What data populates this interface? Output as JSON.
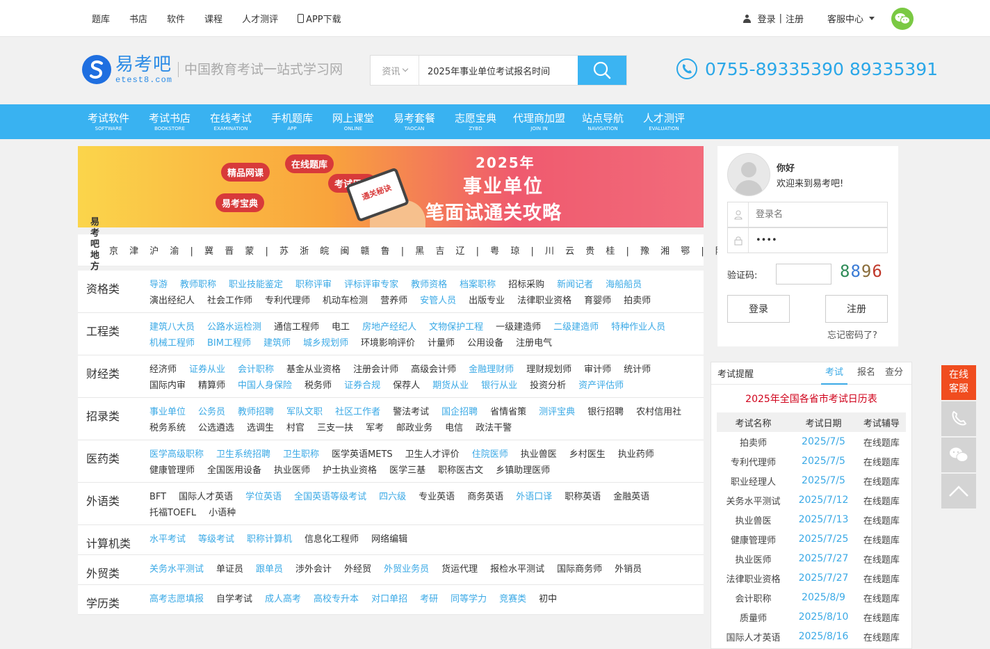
{
  "topnav": {
    "items": [
      "题库",
      "书店",
      "软件",
      "课程",
      "人才测评"
    ],
    "app_download": "APP下载",
    "login": "登录",
    "divider": "|",
    "register": "注册",
    "service": "客服中心"
  },
  "header": {
    "logo_cn": "易考吧",
    "logo_en": "etest8.com",
    "slogan": "中国教育考试一站式学习网",
    "search_category": "资讯",
    "search_value": "2025年事业单位考试报名时间",
    "hotline": "0755-89335390 89335391"
  },
  "mainnav": [
    {
      "cn": "考试软件",
      "en": "SOFTWARE"
    },
    {
      "cn": "考试书店",
      "en": "BOOKSTORE"
    },
    {
      "cn": "在线考试",
      "en": "EXAMINATION"
    },
    {
      "cn": "手机题库",
      "en": "APP"
    },
    {
      "cn": "网上课堂",
      "en": "ONLINE"
    },
    {
      "cn": "易考套餐",
      "en": "TAOCAN"
    },
    {
      "cn": "志愿宝典",
      "en": "ZYBD"
    },
    {
      "cn": "代理商加盟",
      "en": "JOIN IN"
    },
    {
      "cn": "站点导航",
      "en": "NAVIGATION"
    },
    {
      "cn": "人才测评",
      "en": "EVALUATION"
    }
  ],
  "banner": {
    "bubbles": [
      "精品网课",
      "在线题库",
      "考试用书",
      "易考宝典"
    ],
    "phone_text": "通关秘诀",
    "year": "2025年",
    "line1": "事业单位",
    "line2": "笔面试通关攻略"
  },
  "region": {
    "title_line1": "易考吧",
    "title_line2": "地方站",
    "list": "京 津 沪 渝 | 冀 晋 蒙 | 苏 浙 皖 闽 赣 鲁 | 黑 吉 辽 | 粤 琼 | 川 云 贵 桂 | 豫 湘 鄂 | 陕 甘 宁 青 藏 新"
  },
  "categories": [
    {
      "name": "资格类",
      "links": [
        {
          "t": "导游",
          "h": true
        },
        {
          "t": "教师职称",
          "h": true
        },
        {
          "t": "职业技能鉴定",
          "h": true
        },
        {
          "t": "职称评审",
          "h": true
        },
        {
          "t": "评标评审专家",
          "h": true
        },
        {
          "t": "教师资格",
          "h": true
        },
        {
          "t": "档案职称",
          "h": true
        },
        {
          "t": "招标采购",
          "h": false
        },
        {
          "t": "新闻记者",
          "h": true
        },
        {
          "t": "海船船员",
          "h": true
        },
        {
          "t": "演出经纪人",
          "h": false
        },
        {
          "t": "社会工作师",
          "h": false
        },
        {
          "t": "专利代理师",
          "h": false
        },
        {
          "t": "机动车检测",
          "h": false
        },
        {
          "t": "营养师",
          "h": false
        },
        {
          "t": "安管人员",
          "h": true
        },
        {
          "t": "出版专业",
          "h": false
        },
        {
          "t": "法律职业资格",
          "h": false
        },
        {
          "t": "育婴师",
          "h": false
        },
        {
          "t": "拍卖师",
          "h": false
        }
      ]
    },
    {
      "name": "工程类",
      "links": [
        {
          "t": "建筑八大员",
          "h": true
        },
        {
          "t": "公路水运检测",
          "h": true
        },
        {
          "t": "通信工程师",
          "h": false
        },
        {
          "t": "电工",
          "h": false
        },
        {
          "t": "房地产经纪人",
          "h": true
        },
        {
          "t": "文物保护工程",
          "h": true
        },
        {
          "t": "一级建造师",
          "h": false
        },
        {
          "t": "二级建造师",
          "h": true
        },
        {
          "t": "特种作业人员",
          "h": true
        },
        {
          "t": "机械工程师",
          "h": true
        },
        {
          "t": "BIM工程师",
          "h": true
        },
        {
          "t": "建筑师",
          "h": true
        },
        {
          "t": "城乡规划师",
          "h": true
        },
        {
          "t": "环境影响评价",
          "h": false
        },
        {
          "t": "计量师",
          "h": false
        },
        {
          "t": "公用设备",
          "h": false
        },
        {
          "t": "注册电气",
          "h": false
        }
      ]
    },
    {
      "name": "财经类",
      "links": [
        {
          "t": "经济师",
          "h": false
        },
        {
          "t": "证券从业",
          "h": true
        },
        {
          "t": "会计职称",
          "h": true
        },
        {
          "t": "基金从业资格",
          "h": false
        },
        {
          "t": "注册会计师",
          "h": false
        },
        {
          "t": "高级会计师",
          "h": false
        },
        {
          "t": "金融理财师",
          "h": true
        },
        {
          "t": "理财规划师",
          "h": false
        },
        {
          "t": "审计师",
          "h": false
        },
        {
          "t": "统计师",
          "h": false
        },
        {
          "t": "国际内审",
          "h": false
        },
        {
          "t": "精算师",
          "h": false
        },
        {
          "t": "中国人身保险",
          "h": true
        },
        {
          "t": "税务师",
          "h": false
        },
        {
          "t": "证券合规",
          "h": true
        },
        {
          "t": "保荐人",
          "h": false
        },
        {
          "t": "期货从业",
          "h": true
        },
        {
          "t": "银行从业",
          "h": true
        },
        {
          "t": "投资分析",
          "h": false
        },
        {
          "t": "资产评估师",
          "h": true
        }
      ]
    },
    {
      "name": "招录类",
      "links": [
        {
          "t": "事业单位",
          "h": true
        },
        {
          "t": "公务员",
          "h": true
        },
        {
          "t": "教师招聘",
          "h": true
        },
        {
          "t": "军队文职",
          "h": true
        },
        {
          "t": "社区工作者",
          "h": true
        },
        {
          "t": "警法考试",
          "h": false
        },
        {
          "t": "国企招聘",
          "h": true
        },
        {
          "t": "省情省策",
          "h": false
        },
        {
          "t": "测评宝典",
          "h": true
        },
        {
          "t": "银行招聘",
          "h": false
        },
        {
          "t": "农村信用社",
          "h": false
        },
        {
          "t": "税务系统",
          "h": false
        },
        {
          "t": "公选遴选",
          "h": false
        },
        {
          "t": "选调生",
          "h": false
        },
        {
          "t": "村官",
          "h": false
        },
        {
          "t": "三支一扶",
          "h": false
        },
        {
          "t": "军考",
          "h": false
        },
        {
          "t": "邮政业务",
          "h": false
        },
        {
          "t": "电信",
          "h": false
        },
        {
          "t": "政法干警",
          "h": false
        }
      ]
    },
    {
      "name": "医药类",
      "links": [
        {
          "t": "医学高级职称",
          "h": true
        },
        {
          "t": "卫生系统招聘",
          "h": true
        },
        {
          "t": "卫生职称",
          "h": true
        },
        {
          "t": "医学英语METS",
          "h": false
        },
        {
          "t": "卫生人才评价",
          "h": false
        },
        {
          "t": "住院医师",
          "h": true
        },
        {
          "t": "执业兽医",
          "h": false
        },
        {
          "t": "乡村医生",
          "h": false
        },
        {
          "t": "执业药师",
          "h": false
        },
        {
          "t": "健康管理师",
          "h": false
        },
        {
          "t": "全国医用设备",
          "h": false
        },
        {
          "t": "执业医师",
          "h": false
        },
        {
          "t": "护士执业资格",
          "h": false
        },
        {
          "t": "医学三基",
          "h": false
        },
        {
          "t": "职称医古文",
          "h": false
        },
        {
          "t": "乡镇助理医师",
          "h": false
        }
      ]
    },
    {
      "name": "外语类",
      "links": [
        {
          "t": "BFT",
          "h": false
        },
        {
          "t": "国际人才英语",
          "h": false
        },
        {
          "t": "学位英语",
          "h": true
        },
        {
          "t": "全国英语等级考试",
          "h": true
        },
        {
          "t": "四六级",
          "h": true
        },
        {
          "t": "专业英语",
          "h": false
        },
        {
          "t": "商务英语",
          "h": false
        },
        {
          "t": "外语口译",
          "h": true
        },
        {
          "t": "职称英语",
          "h": false
        },
        {
          "t": "金融英语",
          "h": false
        },
        {
          "t": "托福TOEFL",
          "h": false
        },
        {
          "t": "小语种",
          "h": false
        }
      ]
    },
    {
      "name": "计算机类",
      "links": [
        {
          "t": "水平考试",
          "h": true
        },
        {
          "t": "等级考试",
          "h": true
        },
        {
          "t": "职称计算机",
          "h": true
        },
        {
          "t": "信息化工程师",
          "h": false
        },
        {
          "t": "网络编辑",
          "h": false
        }
      ]
    },
    {
      "name": "外贸类",
      "links": [
        {
          "t": "关务水平测试",
          "h": true
        },
        {
          "t": "单证员",
          "h": false
        },
        {
          "t": "跟单员",
          "h": true
        },
        {
          "t": "涉外会计",
          "h": false
        },
        {
          "t": "外经贸",
          "h": false
        },
        {
          "t": "外贸业务员",
          "h": true
        },
        {
          "t": "货运代理",
          "h": false
        },
        {
          "t": "报检水平测试",
          "h": false
        },
        {
          "t": "国际商务师",
          "h": false
        },
        {
          "t": "外销员",
          "h": false
        }
      ]
    },
    {
      "name": "学历类",
      "links": [
        {
          "t": "高考志愿填报",
          "h": true
        },
        {
          "t": "自学考试",
          "h": false
        },
        {
          "t": "成人高考",
          "h": true
        },
        {
          "t": "高校专升本",
          "h": true
        },
        {
          "t": "对口单招",
          "h": true
        },
        {
          "t": "考研",
          "h": true
        },
        {
          "t": "同等学力",
          "h": true
        },
        {
          "t": "竞赛类",
          "h": true
        },
        {
          "t": "初中",
          "h": false
        }
      ]
    }
  ],
  "login": {
    "hello": "你好",
    "welcome": "欢迎来到易考吧!",
    "username_placeholder": "登录名",
    "password_value": "••••",
    "captcha_label": "验证码:",
    "captcha_code": "8896",
    "login_btn": "登录",
    "register_btn": "注册",
    "forgot": "忘记密码了?"
  },
  "exam_reminder": {
    "title": "考试提醒",
    "tabs": [
      "考试",
      "报名",
      "查分"
    ],
    "calendar_title": "2025年全国各省市考试日历表",
    "headers": [
      "考试名称",
      "考试日期",
      "考试辅导"
    ],
    "rows": [
      [
        "拍卖师",
        "2025/7/5",
        "在线题库"
      ],
      [
        "专利代理师",
        "2025/7/5",
        "在线题库"
      ],
      [
        "职业经理人",
        "2025/7/5",
        "在线题库"
      ],
      [
        "关务水平测试",
        "2025/7/12",
        "在线题库"
      ],
      [
        "执业兽医",
        "2025/7/13",
        "在线题库"
      ],
      [
        "健康管理师",
        "2025/7/25",
        "在线题库"
      ],
      [
        "执业医师",
        "2025/7/27",
        "在线题库"
      ],
      [
        "法律职业资格",
        "2025/7/27",
        "在线题库"
      ],
      [
        "会计职称",
        "2025/8/9",
        "在线题库"
      ],
      [
        "质量师",
        "2025/8/10",
        "在线题库"
      ],
      [
        "国际人才英语",
        "2025/8/16",
        "在线题库"
      ]
    ]
  },
  "side_float": {
    "online_line1": "在线",
    "online_line2": "客服"
  },
  "colors": {
    "primary": "#39b2f1",
    "link_highlight": "#3aa9e6",
    "calendar_red": "#d0021b",
    "float_orange": "#f04d1f"
  }
}
